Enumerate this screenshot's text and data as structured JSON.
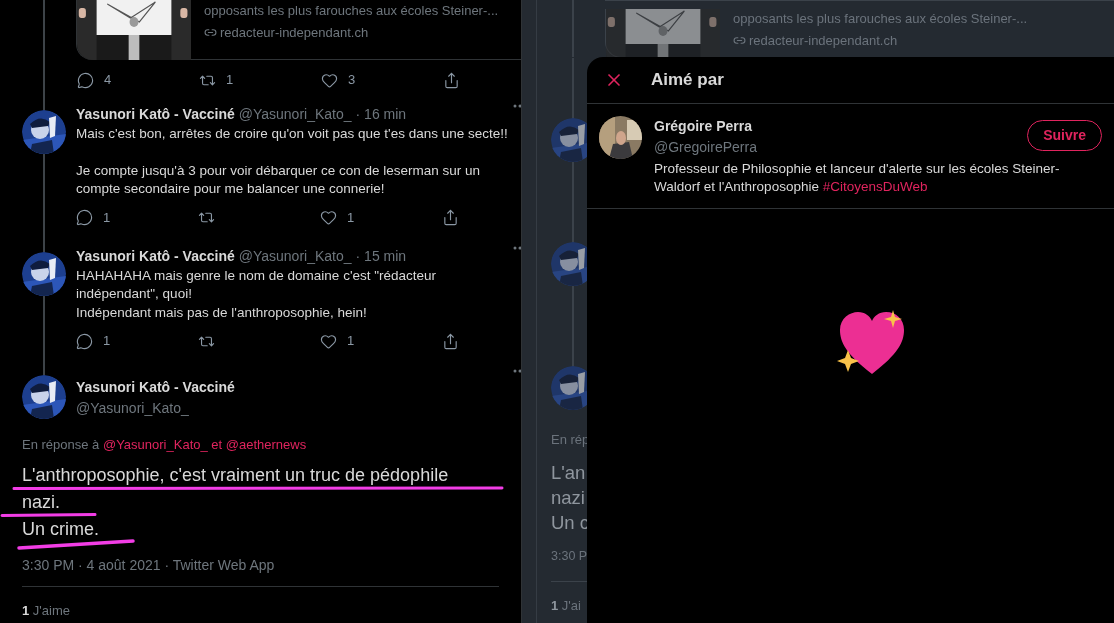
{
  "left": {
    "link_card": {
      "description": "opposants les plus farouches aux écoles Steiner-...",
      "domain": "redacteur-independant.ch"
    },
    "card_actions": [
      {
        "kind": "reply",
        "count": "4"
      },
      {
        "kind": "retweet",
        "count": "1"
      },
      {
        "kind": "like",
        "count": "3"
      },
      {
        "kind": "share"
      }
    ],
    "replies": [
      {
        "name": "Yasunori Katô - Vacciné",
        "handle": "@Yasunori_Kato_",
        "time": "· 16 min",
        "paragraphs": [
          "Mais c'est bon, arrêtes de croire qu'on voit pas que t'es dans une secte!!",
          "Je compte jusqu'à 3 pour voir débarquer ce con de leserman sur un compte secondaire pour me balancer une connerie!"
        ],
        "actions": [
          {
            "kind": "reply",
            "count": "1"
          },
          {
            "kind": "retweet"
          },
          {
            "kind": "like",
            "count": "1"
          },
          {
            "kind": "share"
          }
        ]
      },
      {
        "name": "Yasunori Katô - Vacciné",
        "handle": "@Yasunori_Kato_",
        "time": "· 15 min",
        "paragraphs": [
          "HAHAHAHA mais genre le nom de domaine c'est \"rédacteur indépendant\", quoi!\nIndépendant mais pas de l'anthroposophie, hein!"
        ],
        "actions": [
          {
            "kind": "reply",
            "count": "1"
          },
          {
            "kind": "retweet"
          },
          {
            "kind": "like",
            "count": "1"
          },
          {
            "kind": "share"
          }
        ]
      }
    ],
    "main_tweet": {
      "name": "Yasunori Katô - Vacciné",
      "handle": "@Yasunori_Kato_",
      "reply_prefix": "En réponse à",
      "mentions": [
        "@Yasunori_Kato_",
        "@aethernews"
      ],
      "connector": "et",
      "lines": [
        "L'anthroposophie, c'est vraiment un truc de pédophile",
        "nazi.",
        "Un crime."
      ],
      "meta": "3:30 PM · 4 août 2021 · Twitter Web App",
      "likes_count": "1",
      "likes_label": "J'aime"
    }
  },
  "right": {
    "background": {
      "description": "opposants les plus farouches aux écoles Steiner-...",
      "domain": "redacteur-independant.ch",
      "reply_prefix": "En rép",
      "lines": [
        "L'an",
        "nazi",
        "Un c"
      ],
      "meta": "3:30 P",
      "likes_count": "1",
      "likes_label": "J'ai"
    },
    "modal": {
      "title": "Aimé par",
      "users": [
        {
          "name": "Grégoire Perra",
          "handle": "@GregoirePerra",
          "bio": "Professeur de Philosophie et lanceur d'alerte sur les écoles Steiner-Waldorf et l'Anthroposophie",
          "hashtag": "#CitoyensDuWeb",
          "button": "Suivre"
        }
      ]
    }
  }
}
